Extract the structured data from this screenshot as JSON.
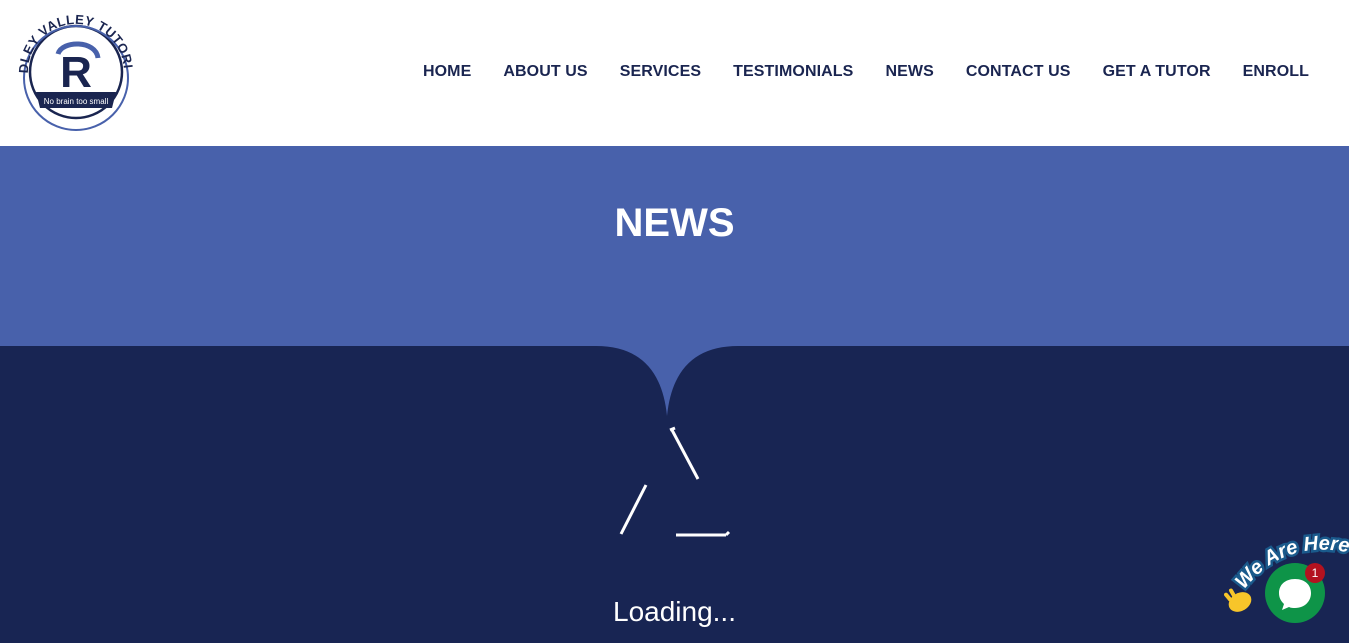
{
  "header": {
    "logo": {
      "ring_text": "RIDLEY VALLEY TUTORIAL",
      "monogram": "R",
      "tagline": "No brain too small"
    },
    "nav": [
      {
        "label": "HOME"
      },
      {
        "label": "ABOUT US"
      },
      {
        "label": "SERVICES"
      },
      {
        "label": "TESTIMONIALS"
      },
      {
        "label": "NEWS"
      },
      {
        "label": "CONTACT US"
      },
      {
        "label": "GET A TUTOR"
      },
      {
        "label": "ENROLL"
      }
    ]
  },
  "hero": {
    "title": "NEWS"
  },
  "loader": {
    "text": "Loading..."
  },
  "chat": {
    "sticker_text": "We Are Here!",
    "badge_count": "1"
  },
  "colors": {
    "hero_bg": "#4861ab",
    "dark_bg": "#182553",
    "nav_text": "#1a2550",
    "chat_green": "#0e9448",
    "badge_red": "#b3121f"
  },
  "icons": [
    "chat-bubble-icon",
    "waving-hand-icon",
    "loading-spinner-icon"
  ]
}
